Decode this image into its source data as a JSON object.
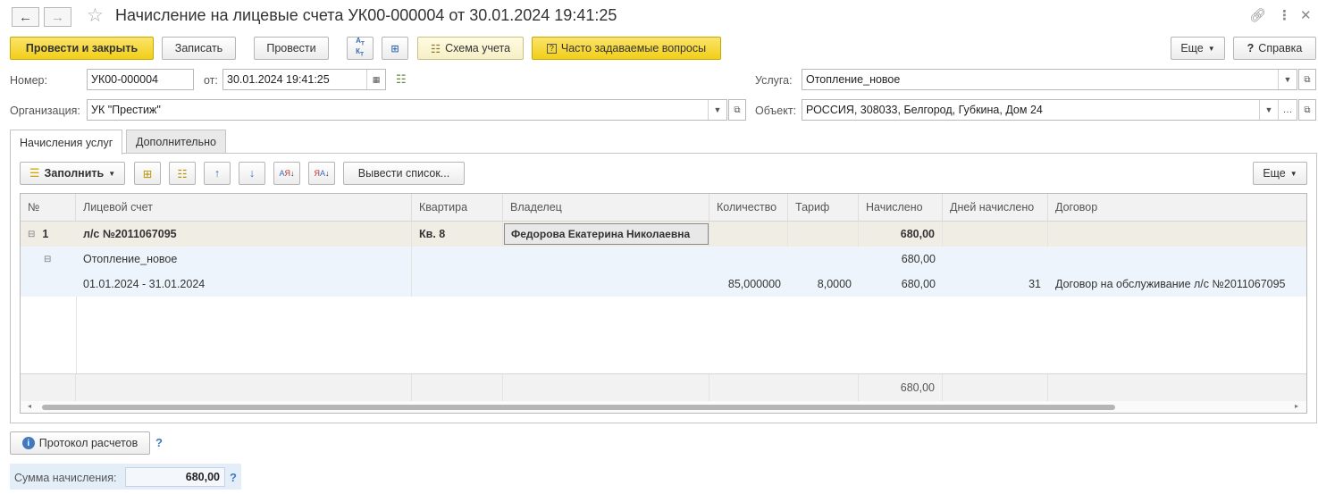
{
  "window": {
    "title": "Начисление на лицевые счета УК00-000004 от 30.01.2024 19:41:25"
  },
  "toolbar": {
    "post_close": "Провести и закрыть",
    "save": "Записать",
    "post": "Провести",
    "dt_kt": "АТ\nКТ",
    "scheme": "Схема учета",
    "faq": "Часто задаваемые вопросы",
    "more": "Еще",
    "help": "Справка"
  },
  "form": {
    "number_label": "Номер:",
    "number_value": "УК00-000004",
    "date_label": "от:",
    "date_value": "30.01.2024 19:41:25",
    "org_label": "Организация:",
    "org_value": "УК \"Престиж\"",
    "service_label": "Услуга:",
    "service_value": "Отопление_новое",
    "object_label": "Объект:",
    "object_value": "РОССИЯ, 308033, Белгород, Губкина, Дом 24"
  },
  "tabs": [
    {
      "label": "Начисления услуг",
      "active": true
    },
    {
      "label": "Дополнительно",
      "active": false
    }
  ],
  "table_toolbar": {
    "fill": "Заполнить",
    "list": "Вывести список...",
    "more": "Еще"
  },
  "table": {
    "columns": [
      "№",
      "Лицевой счет",
      "Квартира",
      "Владелец",
      "Количество",
      "Тариф",
      "Начислено",
      "Дней начислено",
      "Договор"
    ],
    "rows": [
      {
        "num": "1",
        "account": "л/с №2011067095",
        "apartment": "Кв. 8",
        "owner": "Федорова Екатерина Николаевна",
        "qty": "",
        "tariff": "",
        "charged": "680,00",
        "days": "",
        "contract": ""
      },
      {
        "num": "",
        "account": "Отопление_новое",
        "apartment": "",
        "owner": "",
        "qty": "",
        "tariff": "",
        "charged": "680,00",
        "days": "",
        "contract": ""
      },
      {
        "num": "",
        "account": "01.01.2024 - 31.01.2024",
        "apartment": "",
        "owner": "",
        "qty": "85,000000",
        "tariff": "8,0000",
        "charged": "680,00",
        "days": "31",
        "contract": "Договор на обслуживание л/с №2011067095"
      }
    ],
    "total_charged": "680,00"
  },
  "bottom": {
    "protocol": "Протокол расчетов",
    "help_mark": "?",
    "sum_label": "Сумма начисления:",
    "sum_value": "680,00"
  },
  "colors": {
    "accent_yellow": "#f2cf19",
    "group_row_bg": "#f0ede5",
    "subrow_bg": "#eef4fc"
  }
}
